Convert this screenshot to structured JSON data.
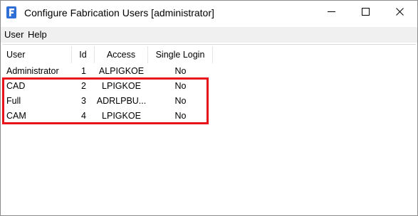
{
  "window": {
    "title": "Configure Fabrication Users [administrator]"
  },
  "icons": {
    "app": "fabrication-app-icon",
    "minimize": "minimize-icon",
    "maximize": "maximize-icon",
    "close": "close-icon"
  },
  "colors": {
    "highlight_border": "#e8131a",
    "app_icon": "#2f6fd6",
    "menubar": "#f0f0f0"
  },
  "menu": {
    "items": [
      {
        "label": "User"
      },
      {
        "label": "Help"
      }
    ]
  },
  "table": {
    "columns": [
      "User",
      "Id",
      "Access",
      "Single Login"
    ],
    "rows": [
      {
        "user": "Administrator",
        "id": "1",
        "access": "ALPIGKOE",
        "single_login": "No"
      },
      {
        "user": "CAD",
        "id": "2",
        "access": "LPIGKOE",
        "single_login": "No"
      },
      {
        "user": "Full",
        "id": "3",
        "access": "ADRLPBU...",
        "single_login": "No"
      },
      {
        "user": "CAM",
        "id": "4",
        "access": "LPIGKOE",
        "single_login": "No"
      }
    ]
  }
}
